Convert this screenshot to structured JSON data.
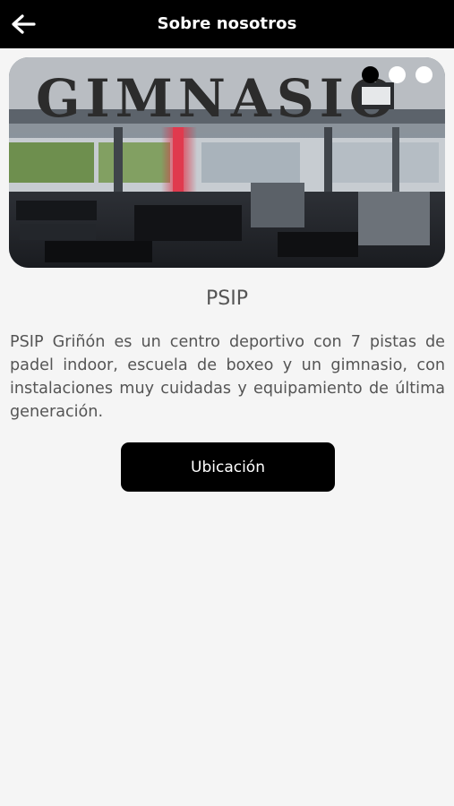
{
  "header": {
    "back_icon": "arrow-left-icon",
    "title": "Sobre nosotros"
  },
  "carousel": {
    "image_sign_text": "GIMNASIO",
    "slide_count": 3,
    "active_index": 0
  },
  "content": {
    "title": "PSIP",
    "description": "PSIP Griñón es un centro deportivo con 7 pistas de padel indoor, escuela de boxeo y un gimnasio, con instalaciones muy cuidadas y equipamiento de última generación.",
    "location_button": "Ubicación"
  },
  "colors": {
    "header_bg": "#000000",
    "page_bg": "#f5f5f5",
    "text": "#555555",
    "button_bg": "#000000",
    "button_text": "#ffffff"
  }
}
